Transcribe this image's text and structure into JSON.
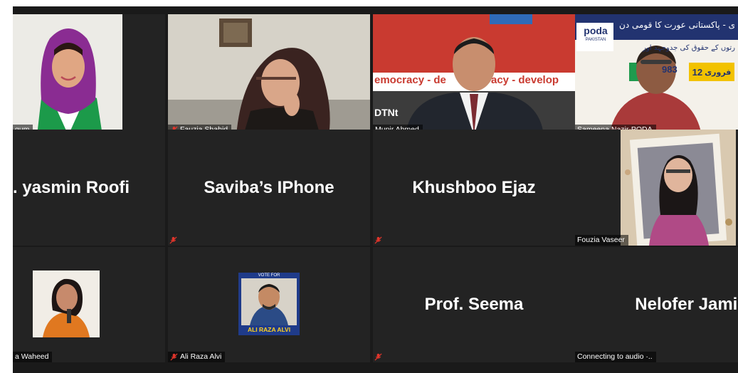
{
  "participants": {
    "t1": {
      "name": "gum",
      "muted": false
    },
    "t2": {
      "name": "Fauzia Shahid",
      "muted": true
    },
    "t3": {
      "name": "Munir Ahmed",
      "muted": false,
      "backdrop_line1": "emocracy - de",
      "backdrop_mid": "acy - develop",
      "backdrop_logo": "DTNt"
    },
    "t4": {
      "name": "Sameena Nazir-PODA",
      "muted": false,
      "logo_text": "poda",
      "logo_sub": "PAKISTAN",
      "banner_title": "ی - پاکستانی عورت کا قومی دن",
      "banner_line2": "رتوں کے حقوق کی جدوجہد اور",
      "date_number": "12",
      "date_text": "فروری",
      "year_text": "983"
    },
    "t5": {
      "label": ". yasmin Roofi",
      "muted": false
    },
    "t6": {
      "label": "Saviba’s IPhone",
      "muted": true
    },
    "t7": {
      "label": "Khushboo Ejaz",
      "muted": true
    },
    "t8": {
      "name": "Fouzia Vaseer",
      "muted": false
    },
    "t9": {
      "name": "a Waheed",
      "muted": false
    },
    "t10": {
      "name": "Ali Raza Alvi",
      "muted": true,
      "poster_top": "VOTE FOR",
      "poster_bottom": "ALI RAZA ALVI"
    },
    "t11": {
      "label": "Prof. Seema",
      "muted": true
    },
    "t12": {
      "label": "Nelofer Jamil",
      "status": "Connecting to audio ·..",
      "muted": false
    }
  },
  "colors": {
    "gallery_bg": "#1a1a1a",
    "tile_bg": "#232323",
    "active_speaker": "#d6e83a",
    "mute_icon": "#e0352b"
  }
}
